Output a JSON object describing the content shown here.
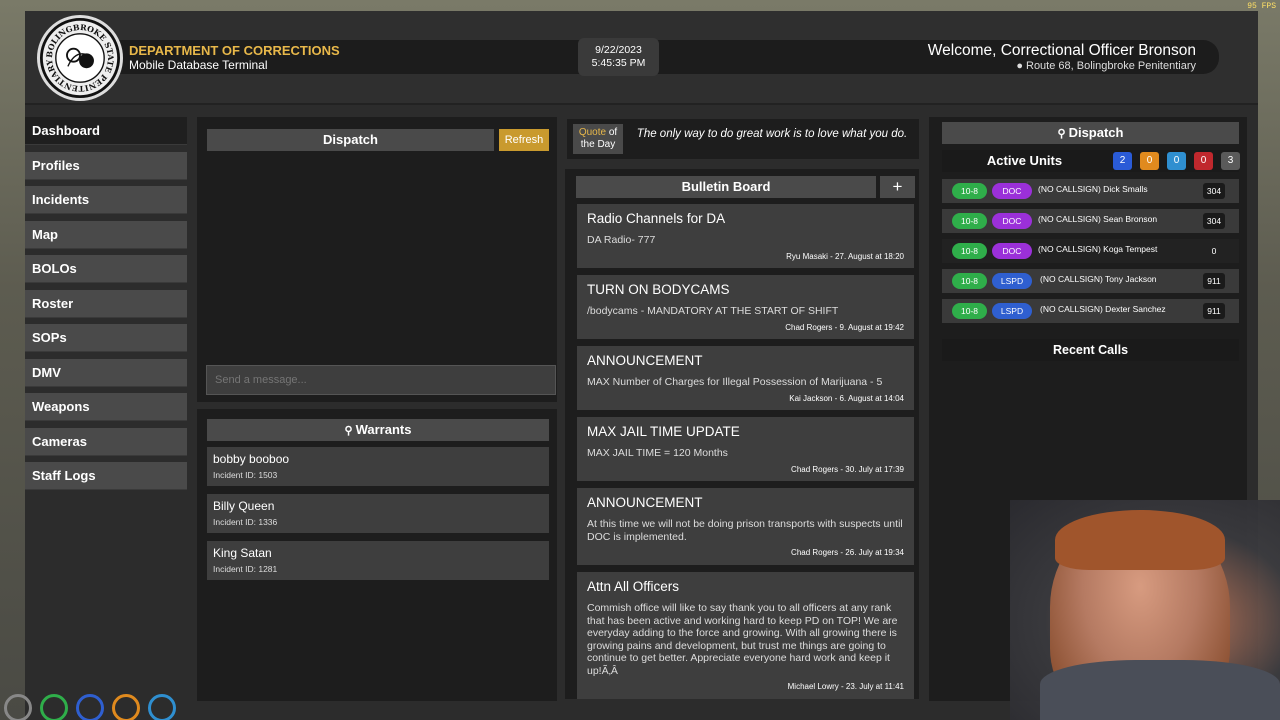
{
  "fps": "95 FPS",
  "header": {
    "seal_text": "BOLINGBROKE STATE PENITENTIARY",
    "department": "DEPARTMENT OF CORRECTIONS",
    "subtitle": "Mobile Database Terminal",
    "date": "9/22/2023",
    "time": "5:45:35 PM",
    "welcome": "Welcome, Correctional Officer Bronson",
    "location": "Route 68, Bolingbroke Penitentiary"
  },
  "sidebar": {
    "items": [
      {
        "label": "Dashboard"
      },
      {
        "label": "Profiles"
      },
      {
        "label": "Incidents"
      },
      {
        "label": "Map"
      },
      {
        "label": "BOLOs"
      },
      {
        "label": "Roster"
      },
      {
        "label": "SOPs"
      },
      {
        "label": "DMV"
      },
      {
        "label": "Weapons"
      },
      {
        "label": "Cameras"
      },
      {
        "label": "Staff Logs"
      }
    ]
  },
  "dispatch": {
    "title": "Dispatch",
    "refresh_label": "Refresh",
    "input_placeholder": "Send a message..."
  },
  "warrants": {
    "title": "Warrants",
    "items": [
      {
        "name": "bobby booboo",
        "incident": "Incident ID: 1503"
      },
      {
        "name": "Billy Queen",
        "incident": "Incident ID: 1336"
      },
      {
        "name": "King Satan",
        "incident": "Incident ID: 1281"
      }
    ]
  },
  "quote": {
    "label_top": "Quote",
    "label_of": "of",
    "label_bottom": "the Day",
    "text": "The only way to do great work is to love what you do."
  },
  "bulletin": {
    "title": "Bulletin Board",
    "add_label": "+",
    "items": [
      {
        "title": "Radio Channels for DA",
        "body": "DA Radio- 777",
        "meta": "Ryu Masaki - 27. August at 18:20"
      },
      {
        "title": "TURN ON BODYCAMS",
        "body": "/bodycams - MANDATORY AT THE START OF SHIFT",
        "meta": "Chad Rogers - 9. August at 19:42"
      },
      {
        "title": "ANNOUNCEMENT",
        "body": "MAX Number of Charges for Illegal Possession of Marijuana - 5",
        "meta": "Kai Jackson - 6. August at 14:04"
      },
      {
        "title": "MAX JAIL TIME UPDATE",
        "body": "MAX JAIL TIME = 120 Months",
        "meta": "Chad Rogers - 30. July at 17:39"
      },
      {
        "title": "ANNOUNCEMENT",
        "body": "At this time we will not be doing prison transports with suspects until DOC is implemented.",
        "meta": "Chad Rogers - 26. July at 19:34"
      },
      {
        "title": "Attn All Officers",
        "body": "Commish office will like to say thank you to all officers at any rank that has been active and working hard to keep PD on TOP! We are everyday adding to the force and growing. With all growing there is growing pains and development, but trust me things are going to continue to get better. Appreciate everyone hard work and keep it up!Ã‚Â",
        "meta": "Michael Lowry - 23. July at 11:41"
      }
    ]
  },
  "right_dispatch": {
    "title": "Dispatch",
    "active_units_label": "Active Units",
    "counts": [
      {
        "value": "2",
        "color": "#2a5bd7"
      },
      {
        "value": "0",
        "color": "#e08a1e"
      },
      {
        "value": "0",
        "color": "#2f8fd0"
      },
      {
        "value": "0",
        "color": "#c0282d"
      },
      {
        "value": "3",
        "color": "#5a5a5a"
      }
    ],
    "units": [
      {
        "status": "10-8",
        "dept": "DOC",
        "dept_color": "#9b30d9",
        "name": "(NO CALLSIGN) Dick Smalls",
        "num": "304"
      },
      {
        "status": "10-8",
        "dept": "DOC",
        "dept_color": "#9b30d9",
        "name": "(NO CALLSIGN) Sean Bronson",
        "num": "304"
      },
      {
        "status": "10-8",
        "dept": "DOC",
        "dept_color": "#9b30d9",
        "name": "(NO CALLSIGN) Koga Tempest",
        "num": "0"
      },
      {
        "status": "10-8",
        "dept": "LSPD",
        "dept_color": "#2f5fd0",
        "name": "(NO CALLSIGN) Tony Jackson",
        "num": "911"
      },
      {
        "status": "10-8",
        "dept": "LSPD",
        "dept_color": "#2f5fd0",
        "name": "(NO CALLSIGN) Dexter Sanchez",
        "num": "911"
      }
    ],
    "recent_calls_label": "Recent Calls"
  }
}
